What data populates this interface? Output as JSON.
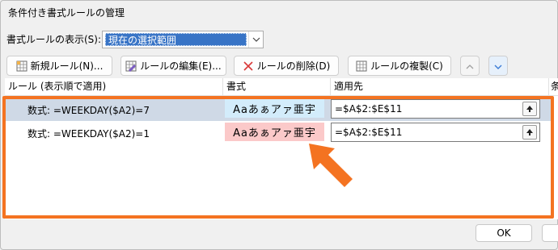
{
  "window": {
    "title": "条件付き書式ルールの管理"
  },
  "show_rules": {
    "label": "書式ルールの表示(S):",
    "selected": "現在の選択範囲"
  },
  "toolbar": {
    "new_rule": "新規ルール(N)...",
    "edit_rule": "ルールの編集(E)...",
    "delete_rule": "ルールの削除(D)",
    "duplicate_rule": "ルールの複製(C)"
  },
  "columns": {
    "rule": "ルール (表示順で適用)",
    "format": "書式",
    "applies_to": "適用先",
    "stop": "条"
  },
  "rules": [
    {
      "rule": "数式: =WEEKDAY($A2)=7",
      "preview": "Aaあぁアァ亜宇",
      "preview_bg": "#d3ecfb",
      "applies_to": "=$A$2:$E$11",
      "selected": true
    },
    {
      "rule": "数式: =WEEKDAY($A2)=1",
      "preview": "Aaあぁアァ亜宇",
      "preview_bg": "#fbc9c9",
      "applies_to": "=$A$2:$E$11",
      "selected": false
    }
  ],
  "footer": {
    "ok": "OK"
  },
  "colors": {
    "accent": "#f47321",
    "selection": "#3874c6"
  }
}
